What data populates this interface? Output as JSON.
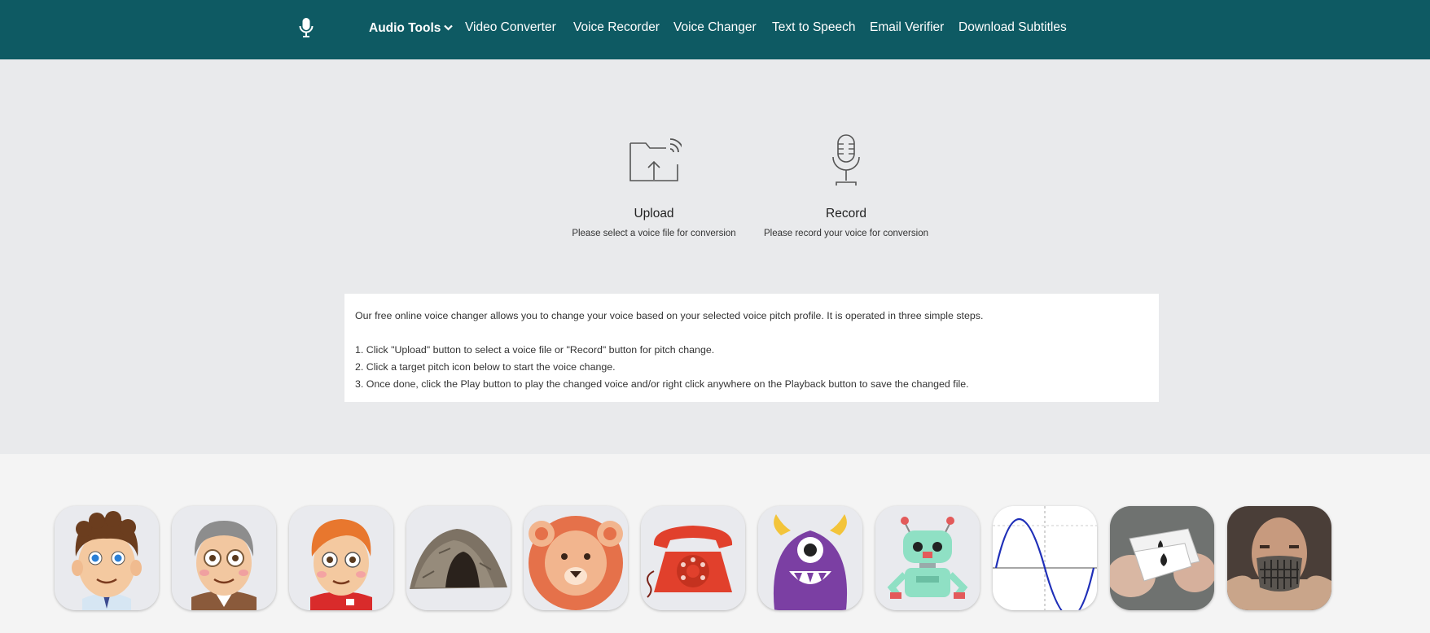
{
  "nav": {
    "logo_icon": "microphone-icon",
    "items": [
      {
        "label": "Audio Tools",
        "has_dropdown": true
      },
      {
        "label": "Video Converter"
      },
      {
        "label": "Voice Recorder"
      },
      {
        "label": "Voice Changer"
      },
      {
        "label": "Text to Speech"
      },
      {
        "label": "Email Verifier"
      },
      {
        "label": "Download Subtitles"
      }
    ]
  },
  "actions": {
    "upload": {
      "icon": "folder-upload-icon",
      "title": "Upload",
      "desc": "Please select a voice file for conversion"
    },
    "record": {
      "icon": "microphone-stand-icon",
      "title": "Record",
      "desc": "Please record your voice for conversion"
    }
  },
  "info": {
    "intro": "Our free online voice changer allows you to change your voice based on your selected voice pitch profile. It is operated in three simple steps.",
    "steps": [
      "1. Click \"Upload\" button to select a voice file or \"Record\" button for pitch change.",
      "2. Click a target pitch icon below to start the voice change.",
      "3. Once done, click the Play button to play the changed voice and/or right click anywhere on the Playback button to save the changed file."
    ]
  },
  "pitch_icons": [
    "boy-curly-hair-icon",
    "old-man-glasses-icon",
    "ginger-kid-icon",
    "cave-icon",
    "lion-icon",
    "telephone-icon",
    "purple-monster-icon",
    "robot-icon",
    "sine-wave-icon",
    "card-trick-icon",
    "masked-villain-icon"
  ],
  "colors": {
    "nav_bg": "#0e5a63",
    "hero_bg": "#e9eaec",
    "strip_bg": "#f4f4f4"
  }
}
